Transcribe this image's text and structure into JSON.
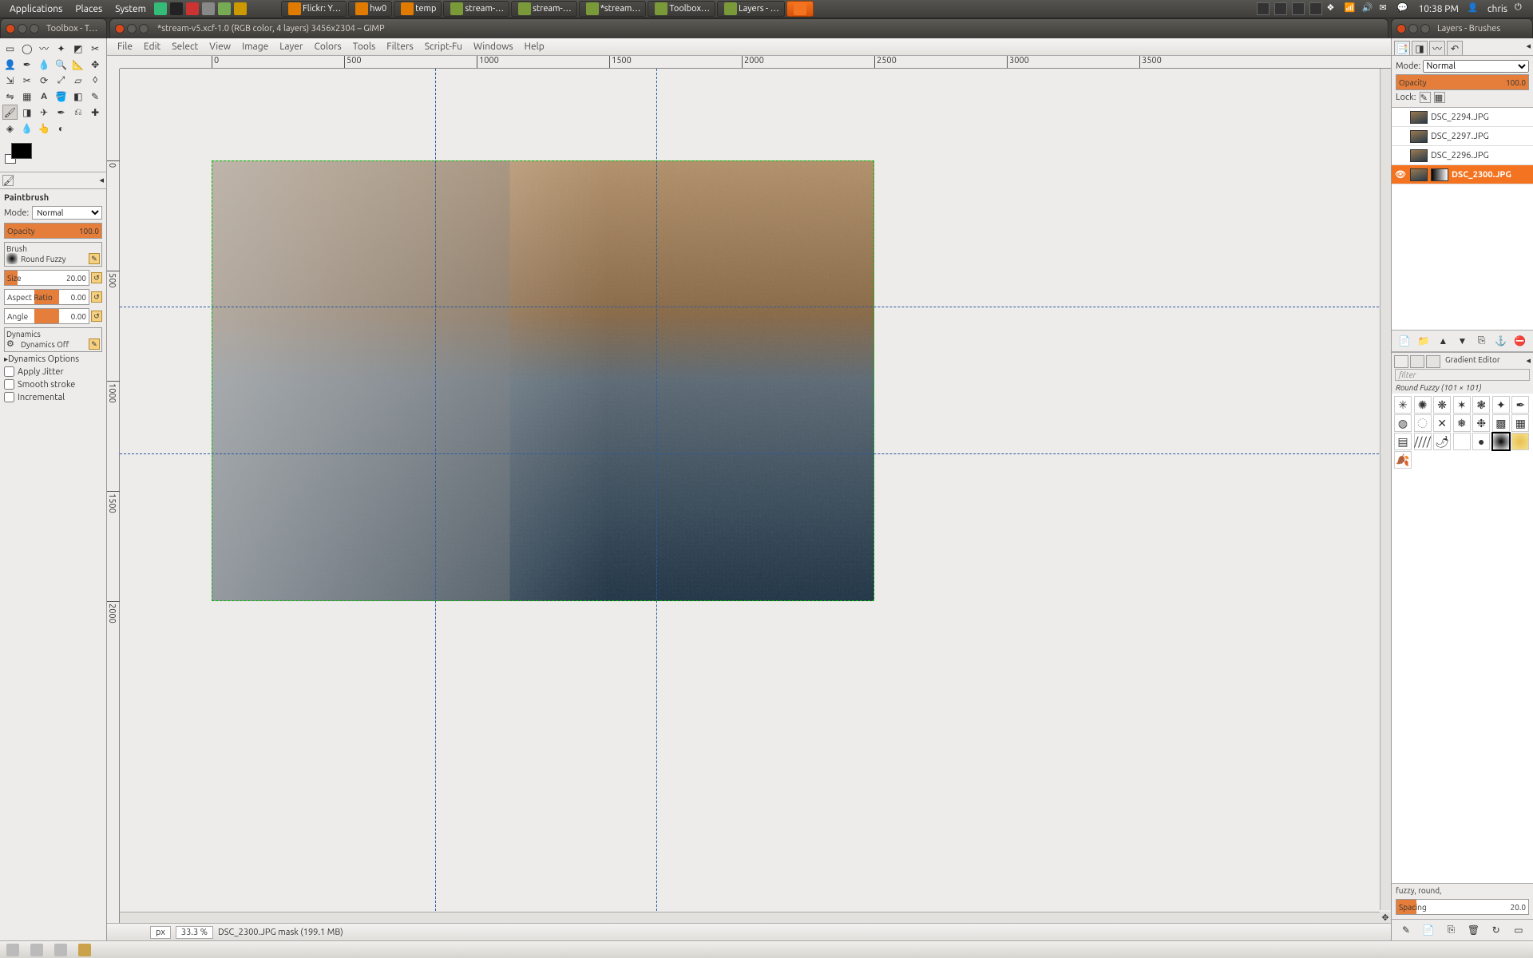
{
  "panel": {
    "menus": [
      "Applications",
      "Places",
      "System"
    ],
    "tasks": [
      {
        "label": "Flickr: Y…",
        "icon": "#e07b00"
      },
      {
        "label": "hw0",
        "icon": "#e07b00"
      },
      {
        "label": "temp",
        "icon": "#e07b00"
      },
      {
        "label": "stream-…",
        "icon": "#7a9a3a"
      },
      {
        "label": "stream-…",
        "icon": "#7a9a3a"
      },
      {
        "label": "*stream…",
        "icon": "#7a9a3a",
        "active": false
      },
      {
        "label": "Toolbox…",
        "icon": "#7a9a3a"
      },
      {
        "label": "Layers - …",
        "icon": "#7a9a3a"
      },
      {
        "label": "",
        "icon": "#f37320",
        "active": true
      }
    ],
    "time": "10:38 PM",
    "user": "chris"
  },
  "titles": {
    "toolbox": "Toolbox - T…",
    "main": "*stream-v5.xcf-1.0 (RGB color, 4 layers) 3456x2304 – GIMP",
    "layers": "Layers - Brushes"
  },
  "menus": [
    "File",
    "Edit",
    "Select",
    "View",
    "Image",
    "Layer",
    "Colors",
    "Tools",
    "Filters",
    "Script-Fu",
    "Windows",
    "Help"
  ],
  "toolbox": {
    "active_tool": "Paintbrush",
    "mode_label": "Mode:",
    "mode_value": "Normal",
    "opacity_label": "Opacity",
    "opacity_value": "100.0",
    "brush_label": "Brush",
    "brush_name": "Round Fuzzy",
    "size_label": "Size",
    "size_value": "20.00",
    "aspect_label": "Aspect Ratio",
    "aspect_value": "0.00",
    "angle_label": "Angle",
    "angle_value": "0.00",
    "dynamics_label": "Dynamics",
    "dynamics_value": "Dynamics Off",
    "dyn_options": "Dynamics Options",
    "jitter": "Apply Jitter",
    "smooth": "Smooth stroke",
    "incremental": "Incremental"
  },
  "ruler_h": [
    "0",
    "500",
    "1000",
    "1500",
    "2000",
    "2500",
    "3000",
    "3500"
  ],
  "ruler_v": [
    "0",
    "500",
    "1000",
    "1500",
    "2000"
  ],
  "status": {
    "unit": "px",
    "zoom": "33.3 %",
    "info": "DSC_2300.JPG mask (199.1 MB)"
  },
  "layers": {
    "mode_label": "Mode:",
    "mode_value": "Normal",
    "opacity_label": "Opacity",
    "opacity_value": "100.0",
    "lock_label": "Lock:",
    "items": [
      {
        "name": "DSC_2294.JPG",
        "visible": false,
        "selected": false
      },
      {
        "name": "DSC_2297.JPG",
        "visible": false,
        "selected": false
      },
      {
        "name": "DSC_2296.JPG",
        "visible": false,
        "selected": false
      },
      {
        "name": "DSC_2300.JPG",
        "visible": true,
        "selected": true
      }
    ]
  },
  "brushes": {
    "editor_label": "Gradient Editor",
    "filter_placeholder": "filter",
    "info": "Round Fuzzy (101 × 101)",
    "tags": "fuzzy, round,",
    "spacing_label": "Spacing",
    "spacing_value": "20.0"
  }
}
